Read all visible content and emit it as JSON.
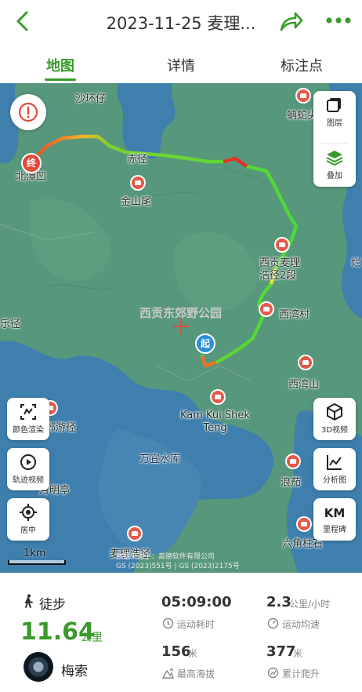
{
  "header": {
    "title": "2023-11-25 麦理...",
    "back_icon": "chevron-left-icon",
    "share_icon": "share-arrow-icon",
    "more_icon": "more-dots-icon",
    "accent": "#3a9a2a"
  },
  "tabs": [
    {
      "label": "地图",
      "active": true
    },
    {
      "label": "详情",
      "active": false
    },
    {
      "label": "标注点",
      "active": false
    }
  ],
  "map": {
    "places": {
      "shahuanzai": "沙环仔",
      "xiejing": "赤径",
      "jinshanwei": "金山尾",
      "beitan": "北潭凹",
      "xiegongdongjiao": "西贡东郊野公园",
      "xiwancun": "西湾村",
      "xiwanshan": "西湾山",
      "maclehose": "西贡麦理\n浩径2段",
      "kamkui": "Kam Kui Shek\nTeng",
      "wanyi": "万宜水库",
      "langjia": "浪茄",
      "manglake": "月明亭",
      "youjing": "郊游径",
      "maclehose_bottom": "麦理浩径",
      "liujiao": "六角柱石",
      "xiejiao": "蚺蛇尖",
      "east_edge": "烂",
      "west_edge": "乐径"
    },
    "start_label": "起",
    "end_label": "终",
    "scale_label": "1km",
    "copyright_line1": "数据来源于：高德软件有限公司",
    "copyright_line2": "GS (2023)551号 | GS (2023)2175号",
    "right_controls": [
      {
        "label": "图层",
        "icon": "layers-icon"
      },
      {
        "label": "叠加",
        "icon": "stack-icon"
      }
    ],
    "left_tools": [
      {
        "label": "颜色渲染",
        "icon": "color-render-icon"
      },
      {
        "label": "轨迹视频",
        "icon": "play-circle-icon"
      },
      {
        "label": "居中",
        "icon": "locate-center-icon"
      }
    ],
    "right_tools": [
      {
        "label": "3D视频",
        "icon": "cube-3d-icon"
      },
      {
        "label": "分析图",
        "icon": "line-chart-icon"
      },
      {
        "label": "里程碑",
        "icon": "km-milestone-icon",
        "badge": "KM"
      }
    ],
    "alert_icon": "alert-circle-icon"
  },
  "stats": {
    "sport": "徒步",
    "distance": "11.64",
    "distance_unit": "公里",
    "username": "梅索",
    "duration": {
      "value": "05:09:00",
      "label": "运动耗时"
    },
    "avg_speed": {
      "value": "2.3",
      "unit": "公里/小时",
      "label": "运动均速"
    },
    "max_altitude": {
      "value": "156",
      "unit": "米",
      "label": "最高海拔"
    },
    "total_climb": {
      "value": "377",
      "unit": "米",
      "label": "累计爬升"
    }
  }
}
